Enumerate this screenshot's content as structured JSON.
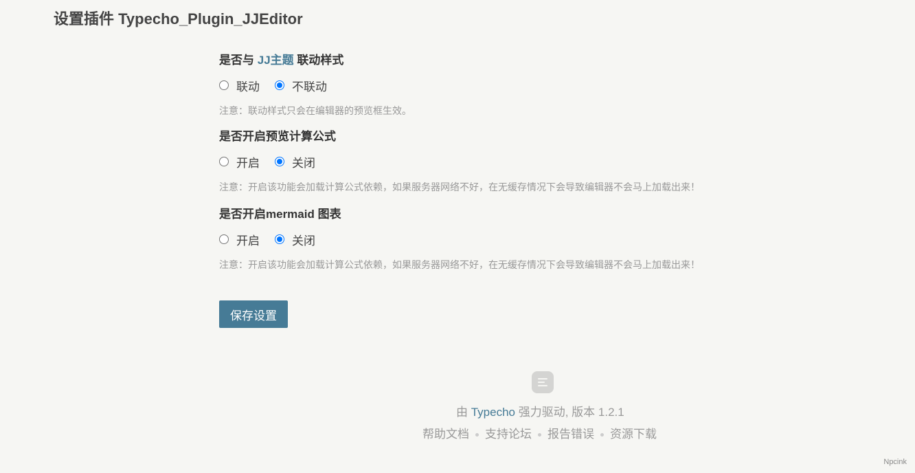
{
  "header": {
    "title": "设置插件 Typecho_Plugin_JJEditor"
  },
  "form": {
    "sections": [
      {
        "label_prefix": "是否与 ",
        "label_link": "JJ主题",
        "label_suffix": " 联动样式",
        "options": [
          {
            "label": "联动",
            "checked": false
          },
          {
            "label": "不联动",
            "checked": true
          }
        ],
        "note": "注意：联动样式只会在编辑器的预览框生效。"
      },
      {
        "label": "是否开启预览计算公式",
        "options": [
          {
            "label": "开启",
            "checked": false
          },
          {
            "label": "关闭",
            "checked": true
          }
        ],
        "note": "注意：开启该功能会加载计算公式依赖，如果服务器网络不好，在无缓存情况下会导致编辑器不会马上加载出来！"
      },
      {
        "label": "是否开启mermaid 图表",
        "options": [
          {
            "label": "开启",
            "checked": false
          },
          {
            "label": "关闭",
            "checked": true
          }
        ],
        "note": "注意：开启该功能会加载计算公式依赖，如果服务器网络不好，在无缓存情况下会导致编辑器不会马上加载出来！"
      }
    ],
    "save_label": "保存设置"
  },
  "footer": {
    "logo_icon": "typecho-logo-icon",
    "powered_prefix": "由 ",
    "powered_link": "Typecho",
    "powered_suffix": " 强力驱动, 版本 1.2.1",
    "links": [
      "帮助文档",
      "支持论坛",
      "报告错误",
      "资源下载"
    ]
  },
  "watermark": "Npcink",
  "colors": {
    "accent": "#467b96",
    "radio_checked": "#0075ff",
    "background": "#f6f6f3"
  }
}
